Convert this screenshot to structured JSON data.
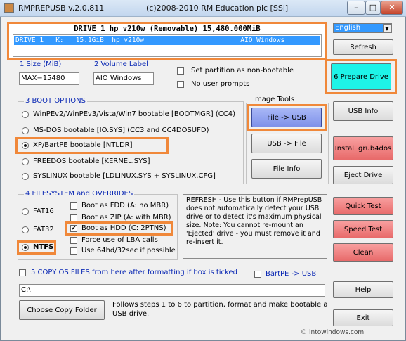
{
  "window": {
    "app_title": "RMPREPUSB v.2.0.811",
    "copyright": "(c)2008-2010 RM Education plc [SSi]",
    "minimize": "–",
    "maximize": "□",
    "close": "✕"
  },
  "drive": {
    "header": "DRIVE 1 hp v210w  (Removable) 15,480.000MiB",
    "selected_row": "DRIVE 1   K:   15.1GiB  hp v210w                        AIO Windows"
  },
  "language": {
    "value": "English"
  },
  "buttons": {
    "refresh": "Refresh",
    "prepare": "6 Prepare Drive",
    "usb_info": "USB Info",
    "install_grub": "Install grub4dos",
    "eject": "Eject Drive",
    "quick_test": "Quick Test",
    "speed_test": "Speed Test",
    "clean": "Clean",
    "help": "Help",
    "exit": "Exit",
    "choose_copy": "Choose Copy Folder"
  },
  "size": {
    "label": "1 Size (MiB)",
    "value": "MAX=15480"
  },
  "volume": {
    "label": "2 Volume Label",
    "value": "AIO Windows"
  },
  "options": {
    "non_bootable": "Set partition as non-bootable",
    "no_prompts": "No user prompts"
  },
  "boot_options": {
    "title": "3 BOOT OPTIONS",
    "items": [
      "WinPEv2/WinPEv3/Vista/Win7 bootable [BOOTMGR] (CC4)",
      "MS-DOS bootable [IO.SYS]   (CC3 and CC4DOSUFD)",
      "XP/BartPE bootable [NTLDR]",
      "FREEDOS bootable [KERNEL.SYS]",
      "SYSLINUX bootable [LDLINUX.SYS + SYSLINUX.CFG]"
    ],
    "selected_index": 2
  },
  "image_tools": {
    "title": "Image Tools",
    "file_to_usb": "File -> USB",
    "usb_to_file": "USB -> File",
    "file_info": "File Info"
  },
  "filesystem": {
    "title": "4 FILESYSTEM and OVERRIDES",
    "fs": [
      "FAT16",
      "FAT32",
      "NTFS"
    ],
    "selected_fs": 2,
    "overrides": [
      "Boot as FDD (A: no MBR)",
      "Boot as ZIP (A: with MBR)",
      "Boot as HDD (C: 2PTNS)",
      "Force use of LBA calls",
      "Use 64hd/32sec if possible"
    ],
    "checked_override": 2
  },
  "info_text": "REFRESH - Use this button if RMPrepUSB does not automatically detect your USB drive or to detect it's maximum physical size. Note: You cannot re-mount an 'Ejected' drive - you must remove it and re-insert it.",
  "copy": {
    "label": "5 COPY OS FILES from here after formatting if box is ticked",
    "path": "C:\\",
    "bartpe": "BartPE -> USB",
    "footer": "Follows steps 1 to 6 to partition, format and make bootable a USB drive."
  },
  "watermark": "intowindows.com",
  "colors": {
    "highlight": "#f0883a",
    "selection": "#3399ff",
    "accent_label": "#0a28b4"
  }
}
